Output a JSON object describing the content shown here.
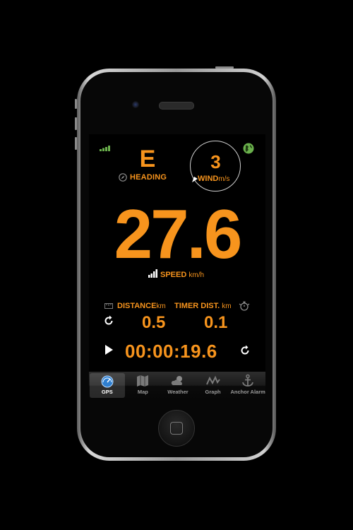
{
  "heading": {
    "direction": "E",
    "label": "HEADING"
  },
  "wind": {
    "value": "3",
    "label": "WIND",
    "unit": "m/s"
  },
  "speed": {
    "value": "27.6",
    "label": "SPEED",
    "unit": "km/h"
  },
  "distance": {
    "label": "DISTANCE",
    "unit": "km",
    "value": "0.5"
  },
  "timer_distance": {
    "label": "TIMER DIST.",
    "unit": "km",
    "value": "0.1"
  },
  "timer": {
    "value": "00:00:19.6"
  },
  "tabs": [
    {
      "label": "GPS",
      "icon": "gauge-icon",
      "active": true
    },
    {
      "label": "Map",
      "icon": "map-icon",
      "active": false
    },
    {
      "label": "Weather",
      "icon": "weather-icon",
      "active": false
    },
    {
      "label": "Graph",
      "icon": "graph-icon",
      "active": false
    },
    {
      "label": "Anchor Alarm",
      "icon": "anchor-icon",
      "active": false
    }
  ],
  "colors": {
    "accent": "#f7941d",
    "signal": "#6ab04c"
  }
}
